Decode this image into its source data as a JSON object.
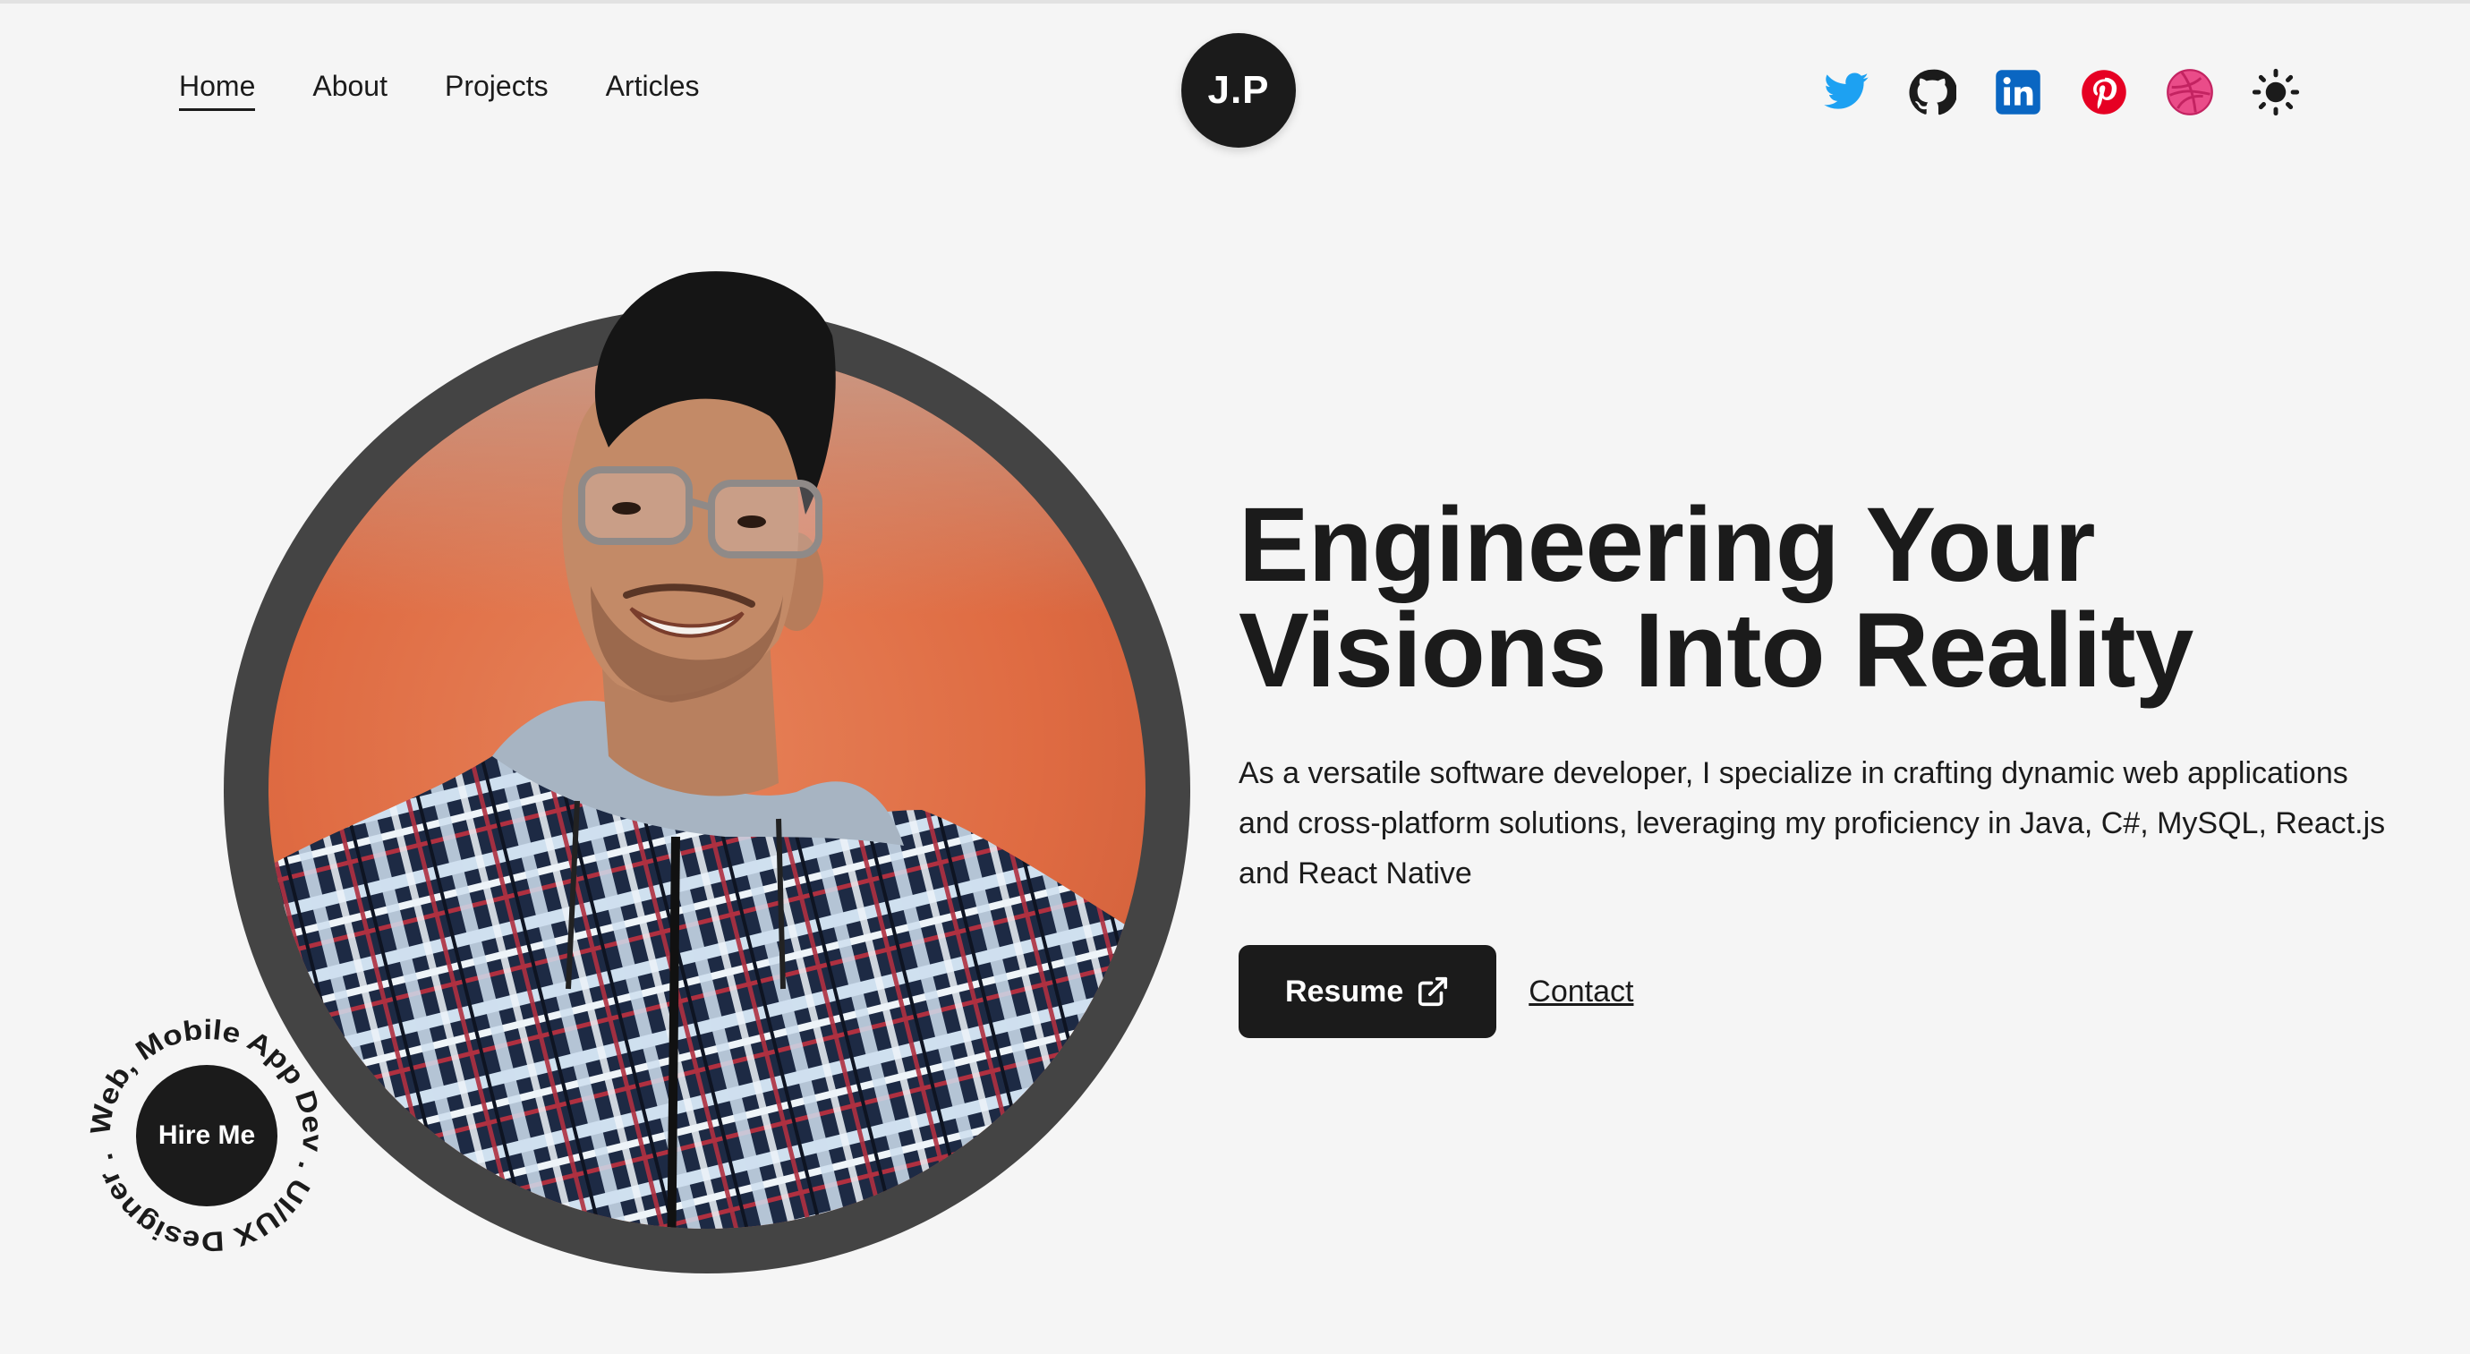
{
  "nav": {
    "links": [
      {
        "label": "Home",
        "active": true
      },
      {
        "label": "About",
        "active": false
      },
      {
        "label": "Projects",
        "active": false
      },
      {
        "label": "Articles",
        "active": false
      }
    ],
    "logo_text": "J.P"
  },
  "socials": [
    {
      "name": "twitter-icon",
      "color": "#1da1f2"
    },
    {
      "name": "github-icon",
      "color": "#1b1b1b"
    },
    {
      "name": "linkedin-icon",
      "color": "#0a66c2"
    },
    {
      "name": "pinterest-icon",
      "color": "#e60023"
    },
    {
      "name": "dribbble-icon",
      "color": "#ea4c89"
    },
    {
      "name": "theme-toggle-sun-icon",
      "color": "#1b1b1b"
    }
  ],
  "badge": {
    "label": "Hire Me",
    "ring_text": "Web, Mobile App Dev . UI/UX Designer . "
  },
  "hero": {
    "headline_line1": "Engineering Your",
    "headline_line2": "Visions Into Reality",
    "description": "As a versatile software developer, I specialize in crafting dynamic web applications and cross-platform solutions, leveraging my proficiency in Java, C#, MySQL, React.js and React Native",
    "resume_label": "Resume",
    "contact_label": "Contact"
  },
  "colors": {
    "background": "#f5f5f5",
    "dark": "#1b1b1b",
    "portrait_ring": "#444444",
    "portrait_bg": "#df6b42"
  }
}
